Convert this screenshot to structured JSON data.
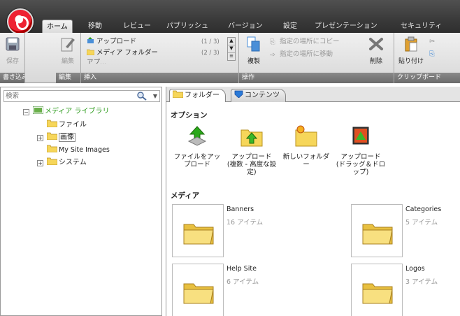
{
  "top_tabs": [
    {
      "label": "ホーム",
      "active": true
    },
    {
      "label": "移動"
    },
    {
      "label": "レビュー"
    },
    {
      "label": "パブリッシュ"
    },
    {
      "label": "バージョン"
    },
    {
      "label": "設定"
    },
    {
      "label": "プレゼンテーション"
    },
    {
      "label": "セキュリティ"
    }
  ],
  "ribbon": {
    "write_group": {
      "label": "書き込み",
      "save": "保存"
    },
    "edit_group": {
      "label": "編集",
      "edit": "編集"
    },
    "insert_group": {
      "label": "挿入",
      "upload": "アップロード",
      "upload_count": "(1 / 3)",
      "media_folder": "メディア フォルダー",
      "media_folder_count": "(2 / 3)",
      "partial": "アプ..."
    },
    "operation_group": {
      "label": "操作",
      "duplicate": "複製",
      "copy_to": "指定の場所にコピー",
      "move_to": "指定の場所に移動",
      "delete": "削除"
    },
    "clipboard_group": {
      "label": "クリップボード",
      "paste": "貼り付け"
    }
  },
  "search": {
    "placeholder": "検索"
  },
  "tree": [
    {
      "label": "メディア ライブラリ",
      "color": "#2a9a1a"
    },
    {
      "label": "ファイル"
    },
    {
      "label": "画像"
    },
    {
      "label": "My Site Images"
    },
    {
      "label": "システム"
    }
  ],
  "content_tabs": [
    {
      "label": "フォルダー",
      "active": true
    },
    {
      "label": "コンテンツ"
    }
  ],
  "options_title": "オプション",
  "options": [
    {
      "label": "ファイルをアップロード"
    },
    {
      "label": "アップロード (複数 - 高度な設定)"
    },
    {
      "label": "新しいフォルダー"
    },
    {
      "label": "アップロード (ドラッグ＆ドロップ)"
    }
  ],
  "media_title": "メディア",
  "media": [
    {
      "name": "Banners",
      "count": "16 アイテム"
    },
    {
      "name": "Categories",
      "count": "5 アイテム"
    },
    {
      "name": "Help Site",
      "count": "6 アイテム"
    },
    {
      "name": "Logos",
      "count": "3 アイテム"
    }
  ],
  "colors": {
    "accent_green": "#2a9a1a",
    "tab_bar": "#3a3a3a",
    "folder_yellow": "#f6d65a"
  }
}
